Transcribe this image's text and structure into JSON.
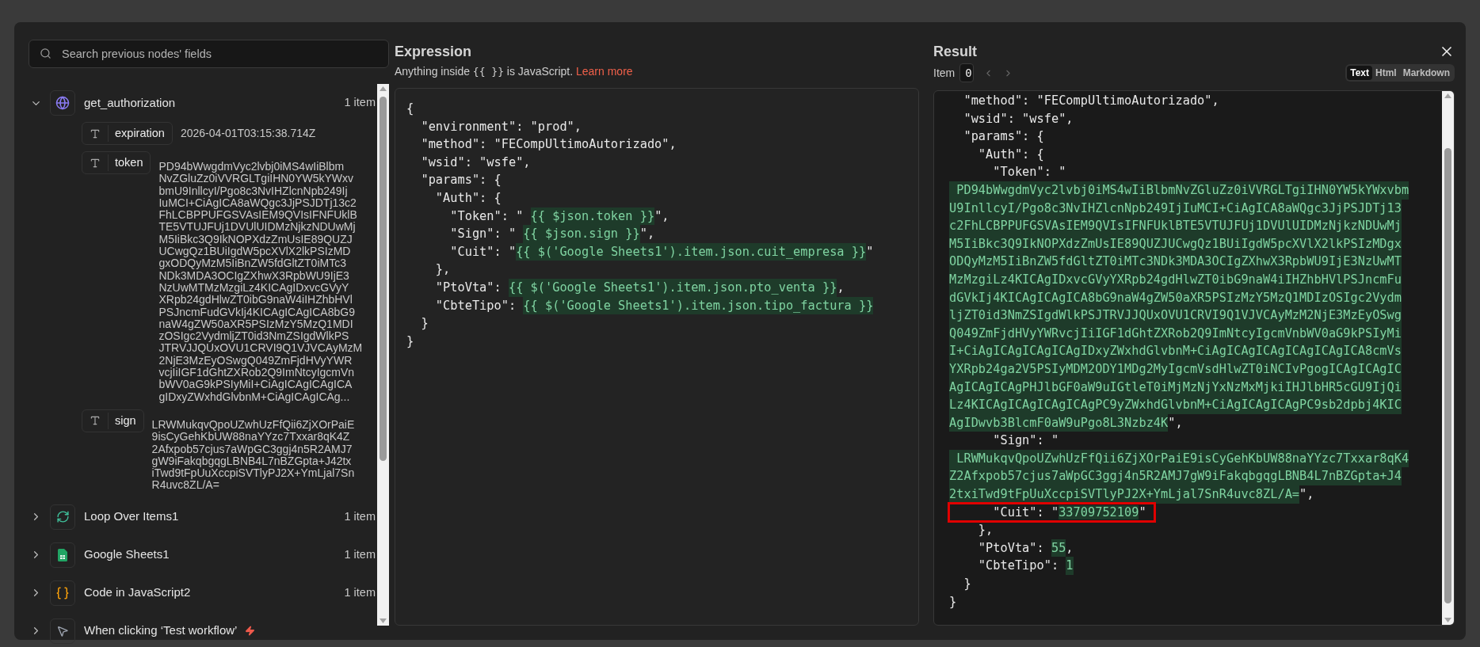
{
  "input_panel": {
    "search": {
      "placeholder": "Search previous nodes' fields"
    },
    "nodes": [
      {
        "name": "get_authorization",
        "kind": "http",
        "count": "1 item",
        "expanded": true,
        "fields": [
          {
            "name": "expiration",
            "value_lines": [
              "2026-04-01T03:15:38.714Z"
            ]
          },
          {
            "name": "token",
            "value_lines": [
              "PD94bWwgdmVyc2lvbj0iMS4wIiBlbm",
              "NvZGluZz0iVVRGLTgiIHN0YW5kYWxv",
              "bmU9InllcyI/Pgo8c3NvIHZlcnNpb249Ij",
              "IuMCI+CiAgICA8aWQgc3JjPSJDTj13c2",
              "FhLCBPPUFGSVAsIEM9QVIsIFNFUklB",
              "TE5VTUJFUj1DVUlUIDMzNjkzNDUwMj",
              "M5IiBkc3Q9IkNOPXdzZmUsIE89QUZJ",
              "UCwgQz1BUiIgdW5pcXVlX2lkPSIzMD",
              "gxODQyMzM5IiBnZW5fdGltZT0iMTc3",
              "NDk3MDA3OCIgZXhwX3RpbWU9IjE3",
              "NzUwMTMzMzgiLz4KICAgIDxvcGVyY",
              "XRpb24gdHlwZT0ibG9naW4iIHZhbHVl",
              "PSJncmFudGVkIj4KICAgICAgICA8bG9",
              "naW4gZW50aXR5PSIzMzY5MzQ1MDI",
              "zOSIgc2VydmljZT0id3NmZSIgdWlkPS",
              "JTRVJJQUxOVU1CRVI9Q1VJVCAyMzM",
              "2NjE3MzEyOSwgQ049ZmFjdHVyYWR",
              "vcjIiIGF1dGhtZXRob2Q9ImNtcyIgcmVn",
              "bWV0aG9kPSIyMiI+CiAgICAgICAgICA",
              "gIDxyZWxhdGlvbnM+CiAgICAgICAg..."
            ]
          },
          {
            "name": "sign",
            "value_lines": [
              "LRWMukqvQpoUZwhUzFfQii6ZjXOrPaiE",
              "9isCyGehKbUW88naYYzc7Txxar8qK4Z",
              "2Afxpob57cjus7aWpGC3ggj4n5R2AMJ7",
              "gW9iFakqbgqgLBNB4L7nBZGpta+J42tx",
              "iTwd9tFpUuXccpiSVTlyPJ2X+YmLjal7Sn",
              "R4uvc8ZL/A="
            ]
          }
        ]
      },
      {
        "name": "Loop Over Items1",
        "kind": "loop",
        "count": "1 item",
        "expanded": false
      },
      {
        "name": "Google Sheets1",
        "kind": "sheets",
        "count": "1 item",
        "expanded": false
      },
      {
        "name": "Code in JavaScript2",
        "kind": "code",
        "count": "1 item",
        "expanded": false
      },
      {
        "name": "When clicking ‘Test workflow’",
        "kind": "trigger",
        "expanded": false
      }
    ]
  },
  "expression": {
    "title": "Expression",
    "hint": {
      "before": "Anything inside ",
      "braces": "{{  }}",
      "after": " is JavaScript. ",
      "link": "Learn more"
    },
    "lines": [
      [
        {
          "kind": "code",
          "text": "{"
        }
      ],
      [
        {
          "kind": "code",
          "text": "  \"environment\": \"prod\","
        }
      ],
      [
        {
          "kind": "code",
          "text": "  \"method\": \"FECompUltimoAutorizado\","
        }
      ],
      [
        {
          "kind": "code",
          "text": "  \"wsid\": \"wsfe\","
        }
      ],
      [
        {
          "kind": "code",
          "text": "  \"params\": {"
        }
      ],
      [
        {
          "kind": "code",
          "text": "    \"Auth\": {"
        }
      ],
      [
        {
          "kind": "code",
          "text": "      \"Token\": \" "
        },
        {
          "kind": "expr",
          "text": "{{ $json.token }}"
        },
        {
          "kind": "code",
          "text": "\","
        }
      ],
      [
        {
          "kind": "code",
          "text": "      \"Sign\": \" "
        },
        {
          "kind": "expr",
          "text": "{{ $json.sign }}"
        },
        {
          "kind": "code",
          "text": "\","
        }
      ],
      [
        {
          "kind": "code",
          "text": "      \"Cuit\": \""
        },
        {
          "kind": "expr",
          "text": "{{ $('Google Sheets1').item.json.cuit_empresa }}"
        },
        {
          "kind": "code",
          "text": "\""
        }
      ],
      [
        {
          "kind": "code",
          "text": "    },"
        }
      ],
      [
        {
          "kind": "code",
          "text": "    \"PtoVta\": "
        },
        {
          "kind": "expr",
          "text": "{{ $('Google Sheets1').item.json.pto_venta }}"
        },
        {
          "kind": "code",
          "text": ","
        }
      ],
      [
        {
          "kind": "code",
          "text": "    \"CbteTipo\": "
        },
        {
          "kind": "expr",
          "text": "{{ $('Google Sheets1').item.json.tipo_factura }}"
        }
      ],
      [
        {
          "kind": "code",
          "text": "  }"
        }
      ],
      [
        {
          "kind": "code",
          "text": "}"
        }
      ]
    ]
  },
  "result": {
    "title": "Result",
    "item_label": "Item",
    "item_value": "0",
    "formats": [
      {
        "label": "Text",
        "selected": true
      },
      {
        "label": "Html",
        "selected": false
      },
      {
        "label": "Markdown",
        "selected": false
      }
    ],
    "lines": [
      {
        "annotated": false,
        "parts": [
          {
            "kind": "code",
            "text": "  \"method\": \"FECompUltimoAutorizado\","
          }
        ]
      },
      {
        "annotated": false,
        "parts": [
          {
            "kind": "code",
            "text": "  \"wsid\": \"wsfe\","
          }
        ]
      },
      {
        "annotated": false,
        "parts": [
          {
            "kind": "code",
            "text": "  \"params\": {"
          }
        ]
      },
      {
        "annotated": false,
        "parts": [
          {
            "kind": "code",
            "text": "    \"Auth\": {"
          }
        ]
      },
      {
        "annotated": false,
        "parts": [
          {
            "kind": "code",
            "text": "      \"Token\": \""
          }
        ]
      },
      {
        "annotated": false,
        "parts": [
          {
            "kind": "expr",
            "text": " PD94bWwgdmVyc2lvbj0iMS4wIiBlbmNvZGluZz0iVVRGLTgiIHN0YW5kYWxvbm"
          }
        ]
      },
      {
        "annotated": false,
        "parts": [
          {
            "kind": "expr",
            "text": "U9InllcyI/Pgo8c3NvIHZlcnNpb249IjIuMCI+CiAgICA8aWQgc3JjPSJDTj13"
          }
        ]
      },
      {
        "annotated": false,
        "parts": [
          {
            "kind": "expr",
            "text": "c2FhLCBPPUFGSVAsIEM9QVIsIFNFUklBTE5VTUJFUj1DVUlUIDMzNjkzNDUwMj"
          }
        ]
      },
      {
        "annotated": false,
        "parts": [
          {
            "kind": "expr",
            "text": "M5IiBkc3Q9IkNOPXdzZmUsIE89QUZJUCwgQz1BUiIgdW5pcXVlX2lkPSIzMDgx"
          }
        ]
      },
      {
        "annotated": false,
        "parts": [
          {
            "kind": "expr",
            "text": "ODQyMzM5IiBnZW5fdGltZT0iMTc3NDk3MDA3OCIgZXhwX3RpbWU9IjE3NzUwMT"
          }
        ]
      },
      {
        "annotated": false,
        "parts": [
          {
            "kind": "expr",
            "text": "MzMzgiLz4KICAgIDxvcGVyYXRpb24gdHlwZT0ibG9naW4iIHZhbHVlPSJncmFu"
          }
        ]
      },
      {
        "annotated": false,
        "parts": [
          {
            "kind": "expr",
            "text": "dGVkIj4KICAgICAgICA8bG9naW4gZW50aXR5PSIzMzY5MzQ1MDIzOSIgc2Vydm"
          }
        ]
      },
      {
        "annotated": false,
        "parts": [
          {
            "kind": "expr",
            "text": "ljZT0id3NmZSIgdWlkPSJTRVJJQUxOVU1CRVI9Q1VJVCAyMzM2NjE3MzEyOSwg"
          }
        ]
      },
      {
        "annotated": false,
        "parts": [
          {
            "kind": "expr",
            "text": "Q049ZmFjdHVyYWRvcjIiIGF1dGhtZXRob2Q9ImNtcyIgcmVnbWV0aG9kPSIyMi"
          }
        ]
      },
      {
        "annotated": false,
        "parts": [
          {
            "kind": "expr",
            "text": "I+CiAgICAgICAgICAgIDxyZWxhdGlvbnM+CiAgICAgICAgICAgICAgICA8cmVs"
          }
        ]
      },
      {
        "annotated": false,
        "parts": [
          {
            "kind": "expr",
            "text": "YXRpb24ga2V5PSIyMDM2ODY1MDg2MyIgcmVsdHlwZT0iNCIvPgogICAgICAgIC"
          }
        ]
      },
      {
        "annotated": false,
        "parts": [
          {
            "kind": "expr",
            "text": "AgICAgICAgPHJlbGF0aW9uIGtleT0iMjMzNjYxNzMxMjkiIHJlbHR5cGU9IjQi"
          }
        ]
      },
      {
        "annotated": false,
        "parts": [
          {
            "kind": "expr",
            "text": "Lz4KICAgICAgICAgICAgPC9yZWxhdGlvbnM+CiAgICAgICAgPC9sb2dpbj4KIC"
          }
        ]
      },
      {
        "annotated": false,
        "parts": [
          {
            "kind": "expr",
            "text": "AgIDwvb3BlcmF0aW9uPgo8L3Nzbz4K"
          },
          {
            "kind": "code",
            "text": "\","
          }
        ]
      },
      {
        "annotated": false,
        "parts": [
          {
            "kind": "code",
            "text": "      \"Sign\": \""
          }
        ]
      },
      {
        "annotated": false,
        "parts": [
          {
            "kind": "expr",
            "text": " LRWMukqvQpoUZwhUzFfQii6ZjXOrPaiE9isCyGehKbUW88naYYzc7Txxar8qK4"
          }
        ]
      },
      {
        "annotated": false,
        "parts": [
          {
            "kind": "expr",
            "text": "Z2Afxpob57cjus7aWpGC3ggj4n5R2AMJ7gW9iFakqbgqgLBNB4L7nBZGpta+J4"
          }
        ]
      },
      {
        "annotated": false,
        "parts": [
          {
            "kind": "expr",
            "text": "2txiTwd9tFpUuXccpiSVTlyPJ2X+YmLjal7SnR4uvc8ZL/A="
          },
          {
            "kind": "code",
            "text": "\","
          }
        ]
      },
      {
        "annotated": true,
        "parts": [
          {
            "kind": "code",
            "text": "      \"Cuit\": \""
          },
          {
            "kind": "expr",
            "text": "33709752109"
          },
          {
            "kind": "code",
            "text": "\""
          }
        ]
      },
      {
        "annotated": false,
        "parts": [
          {
            "kind": "code",
            "text": "    },"
          }
        ]
      },
      {
        "annotated": false,
        "parts": [
          {
            "kind": "code",
            "text": "    \"PtoVta\": "
          },
          {
            "kind": "expr",
            "text": "55"
          },
          {
            "kind": "code",
            "text": ","
          }
        ]
      },
      {
        "annotated": false,
        "parts": [
          {
            "kind": "code",
            "text": "    \"CbteTipo\": "
          },
          {
            "kind": "expr",
            "text": "1"
          }
        ]
      },
      {
        "annotated": false,
        "parts": [
          {
            "kind": "code",
            "text": "  }"
          }
        ]
      },
      {
        "annotated": false,
        "parts": [
          {
            "kind": "code",
            "text": "}"
          }
        ]
      }
    ]
  }
}
